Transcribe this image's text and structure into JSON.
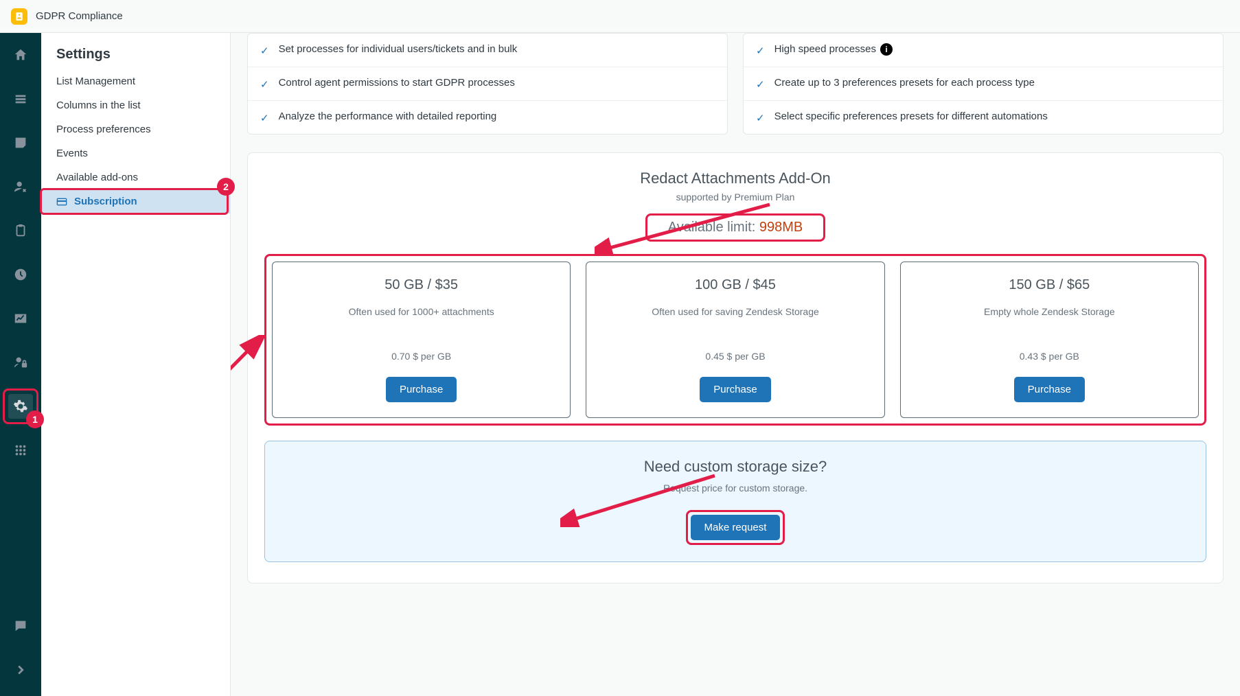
{
  "topbar": {
    "title": "GDPR Compliance"
  },
  "navrail": {
    "items": [
      {
        "name": "home-icon"
      },
      {
        "name": "list-icon"
      },
      {
        "name": "inbox-icon"
      },
      {
        "name": "user-remove-icon"
      },
      {
        "name": "clipboard-icon"
      },
      {
        "name": "clock-icon"
      },
      {
        "name": "chart-icon"
      },
      {
        "name": "user-lock-icon"
      },
      {
        "name": "gear-icon"
      },
      {
        "name": "grid-icon"
      }
    ],
    "bottom": [
      {
        "name": "chat-icon"
      },
      {
        "name": "chevron-right-icon"
      }
    ],
    "highlight_badge": "1"
  },
  "sidebar": {
    "title": "Settings",
    "items": [
      {
        "label": "List Management"
      },
      {
        "label": "Columns in the list"
      },
      {
        "label": "Process preferences"
      },
      {
        "label": "Events"
      },
      {
        "label": "Available add-ons"
      },
      {
        "label": "Subscription",
        "active": true
      }
    ],
    "highlight_badge": "2"
  },
  "features": {
    "left": [
      "Set processes for individual users/tickets and in bulk",
      "Control agent permissions to start GDPR processes",
      "Analyze the performance with detailed reporting"
    ],
    "right": [
      {
        "text": "High speed processes",
        "info": true
      },
      {
        "text": "Create up to 3 preferences presets for each process type"
      },
      {
        "text": "Select specific preferences presets for different automations"
      }
    ]
  },
  "addon": {
    "title": "Redact Attachments Add-On",
    "subtitle": "supported by Premium Plan",
    "limit_label": "Available limit: ",
    "limit_value": "998MB",
    "plans": [
      {
        "head": "50 GB / $35",
        "desc": "Often used for 1000+ attachments",
        "rate": "0.70 $ per GB",
        "btn": "Purchase"
      },
      {
        "head": "100 GB / $45",
        "desc": "Often used for saving Zendesk Storage",
        "rate": "0.45 $ per GB",
        "btn": "Purchase"
      },
      {
        "head": "150 GB / $65",
        "desc": "Empty whole Zendesk Storage",
        "rate": "0.43 $ per GB",
        "btn": "Purchase"
      }
    ],
    "custom": {
      "title": "Need custom storage size?",
      "sub": "Request price for custom storage.",
      "btn": "Make request"
    }
  }
}
